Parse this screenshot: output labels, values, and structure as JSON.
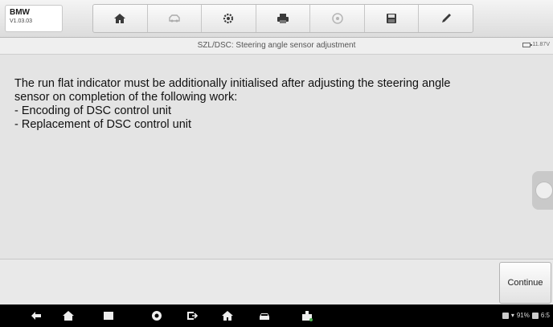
{
  "brand": {
    "name": "BMW",
    "version": "V1.03.03"
  },
  "toolbar": {
    "items": [
      "home-icon",
      "vehicle-swap-icon",
      "settings-icon",
      "print-icon",
      "help-icon",
      "save-icon",
      "edit-icon"
    ]
  },
  "titlebar": {
    "title": "SZL/DSC: Steering angle sensor adjustment",
    "battery": "11.87V"
  },
  "message": {
    "line1": "The run flat indicator must be additionally initialised after adjusting the steering angle",
    "line2": "sensor on completion of the following work:",
    "line3": "- Encoding of DSC control unit",
    "line4": "- Replacement of DSC control unit"
  },
  "actions": {
    "continue_label": "Continue"
  },
  "statusbar": {
    "battery_text": "91%",
    "time": "6:5"
  },
  "colors": {
    "background": "#e4e4e4",
    "navbar": "#000000"
  }
}
